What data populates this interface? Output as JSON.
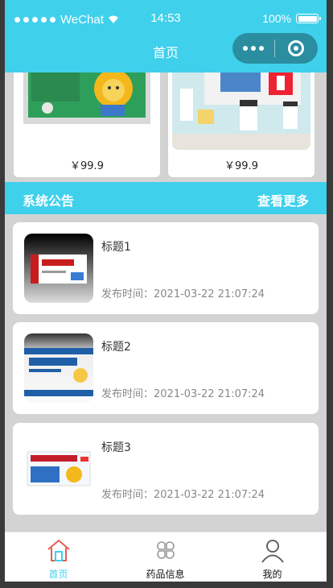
{
  "status_bar": {
    "carrier": "WeChat",
    "time": "14:53",
    "battery": "100%"
  },
  "nav": {
    "title": "首页"
  },
  "products": [
    {
      "price": "￥99.9"
    },
    {
      "price": "￥99.9"
    }
  ],
  "notice": {
    "title": "系统公告",
    "more": "查看更多"
  },
  "news": [
    {
      "title": "标题1",
      "time": "发布时间：2021-03-22 21:07:24"
    },
    {
      "title": "标题2",
      "time": "发布时间：2021-03-22 21:07:24"
    },
    {
      "title": "标题3",
      "time": "发布时间：2021-03-22 21:07:24"
    }
  ],
  "tabbar": {
    "items": [
      {
        "label": "首页",
        "icon": "home-icon",
        "active": true
      },
      {
        "label": "药品信息",
        "icon": "grid-icon",
        "active": false
      },
      {
        "label": "我的",
        "icon": "user-icon",
        "active": false
      }
    ]
  },
  "colors": {
    "accent": "#3fd0ec",
    "capsule": "#2a8ea0"
  }
}
